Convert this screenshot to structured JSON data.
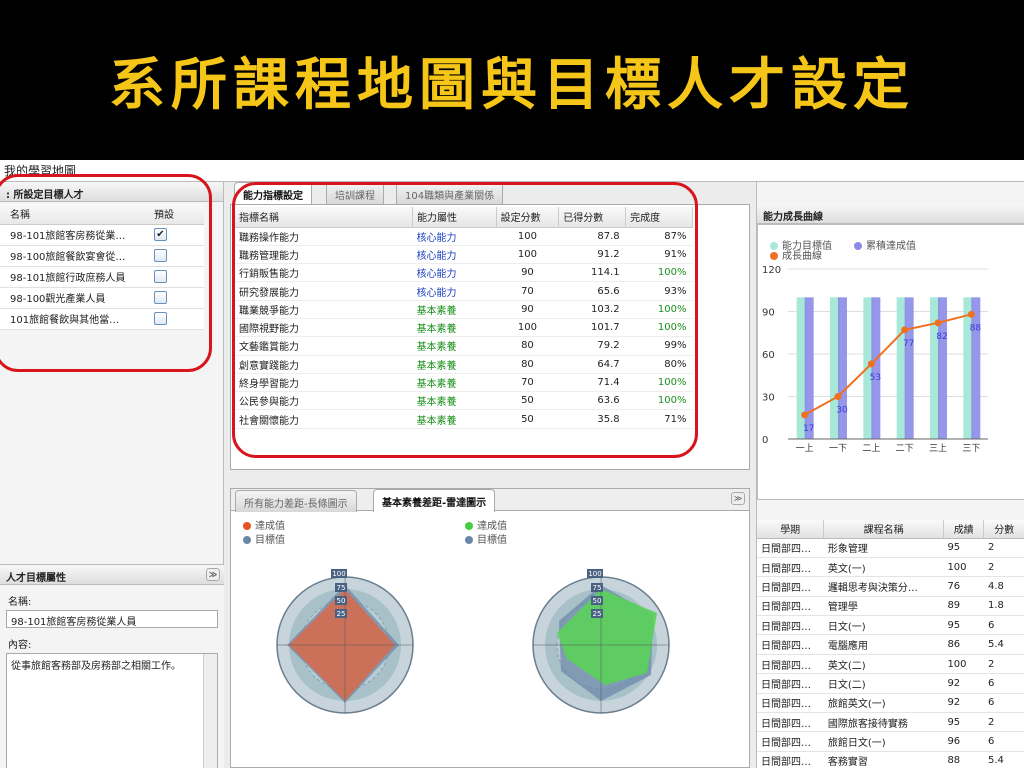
{
  "slide_title": "系所課程地圖與目標人才設定",
  "app": {
    "title": "我的學習地圖"
  },
  "target_section": {
    "title": ": 所設定目標人才",
    "headers": {
      "name": "名稱",
      "default": "預設"
    },
    "rows": [
      {
        "name": "98-101旅館客房務從業…",
        "checked": true
      },
      {
        "name": "98-100旅館餐飲宴會從…",
        "checked": false
      },
      {
        "name": "98-101旅館行政庶務人員",
        "checked": false
      },
      {
        "name": "98-100觀光產業人員",
        "checked": false
      },
      {
        "name": "101旅館餐飲與其他當…",
        "checked": false
      }
    ]
  },
  "attr_section": {
    "title": "人才目標屬性",
    "name_label": "名稱:",
    "name_value": "98-101旅館客房務從業人員",
    "content_label": "內容:",
    "content_value": "從事旅館客務部及房務部之相關工作。"
  },
  "center_tabs": [
    "能力指標設定",
    "培訓課程",
    "104職類與產業關係"
  ],
  "ability_table": {
    "headers": [
      "指標名稱",
      "能力屬性",
      "設定分數",
      "已得分數",
      "完成度"
    ],
    "rows": [
      {
        "name": "職務操作能力",
        "attr": "核心能力",
        "type": "core",
        "set": "100",
        "got": "87.8",
        "pct": "87%",
        "pct_green": false
      },
      {
        "name": "職務管理能力",
        "attr": "核心能力",
        "type": "core",
        "set": "100",
        "got": "91.2",
        "pct": "91%",
        "pct_green": false
      },
      {
        "name": "行銷販售能力",
        "attr": "核心能力",
        "type": "core",
        "set": "90",
        "got": "114.1",
        "pct": "100%",
        "pct_green": true
      },
      {
        "name": "研究發展能力",
        "attr": "核心能力",
        "type": "core",
        "set": "70",
        "got": "65.6",
        "pct": "93%",
        "pct_green": false
      },
      {
        "name": "職業競爭能力",
        "attr": "基本素養",
        "type": "basic",
        "set": "90",
        "got": "103.2",
        "pct": "100%",
        "pct_green": true
      },
      {
        "name": "國際視野能力",
        "attr": "基本素養",
        "type": "basic",
        "set": "100",
        "got": "101.7",
        "pct": "100%",
        "pct_green": true
      },
      {
        "name": "文藝鑑賞能力",
        "attr": "基本素養",
        "type": "basic",
        "set": "80",
        "got": "79.2",
        "pct": "99%",
        "pct_green": false
      },
      {
        "name": "創意實踐能力",
        "attr": "基本素養",
        "type": "basic",
        "set": "80",
        "got": "64.7",
        "pct": "80%",
        "pct_green": false
      },
      {
        "name": "終身學習能力",
        "attr": "基本素養",
        "type": "basic",
        "set": "70",
        "got": "71.4",
        "pct": "100%",
        "pct_green": true
      },
      {
        "name": "公民參與能力",
        "attr": "基本素養",
        "type": "basic",
        "set": "50",
        "got": "63.6",
        "pct": "100%",
        "pct_green": true
      },
      {
        "name": "社會關懷能力",
        "attr": "基本素養",
        "type": "basic",
        "set": "50",
        "got": "35.8",
        "pct": "71%",
        "pct_green": false
      }
    ]
  },
  "radar_tabs": [
    "所有能力差距-長條圖示",
    "基本素養差距-雷達圖示"
  ],
  "radar_legend": {
    "left": [
      {
        "label": "達成值",
        "color": "#e8502a"
      },
      {
        "label": "目標值",
        "color": "#6a86a8"
      }
    ],
    "right": [
      {
        "label": "達成值",
        "color": "#44cc44"
      },
      {
        "label": "目標值",
        "color": "#6a86a8"
      }
    ]
  },
  "radar_axis_labels": [
    "100",
    "75",
    "50",
    "25"
  ],
  "growth_chart": {
    "title": "能力成長曲線",
    "legend": [
      "能力目標值",
      "累積達成值",
      "成長曲線"
    ],
    "colors": {
      "target": "#a8e8d8",
      "achieved": "#8c8ce8",
      "line": "#f07020"
    }
  },
  "chart_data": {
    "type": "bar",
    "title": "能力成長曲線",
    "categories": [
      "一上",
      "一下",
      "二上",
      "二下",
      "三上",
      "三下"
    ],
    "series": [
      {
        "name": "能力目標值",
        "values": [
          100,
          100,
          100,
          100,
          100,
          100
        ]
      },
      {
        "name": "累積達成值",
        "values": [
          17,
          30,
          53,
          77,
          82,
          88
        ]
      },
      {
        "name": "成長曲線",
        "values": [
          17,
          30,
          53,
          77,
          82,
          88
        ]
      }
    ],
    "y_ticks": [
      "0",
      "30",
      "60",
      "90",
      "120"
    ],
    "ylim": [
      0,
      120
    ]
  },
  "course_table": {
    "headers": [
      "學期",
      "課程名稱",
      "成績",
      "分數"
    ],
    "rows": [
      [
        "日間部四…",
        "形象管理",
        "95",
        "2"
      ],
      [
        "日間部四…",
        "英文(一)",
        "100",
        "2"
      ],
      [
        "日間部四…",
        "邏輯思考與決策分…",
        "76",
        "4.8"
      ],
      [
        "日間部四…",
        "管理學",
        "89",
        "1.8"
      ],
      [
        "日間部四…",
        "日文(一)",
        "95",
        "6"
      ],
      [
        "日間部四…",
        "電腦應用",
        "86",
        "5.4"
      ],
      [
        "日間部四…",
        "英文(二)",
        "100",
        "2"
      ],
      [
        "日間部四…",
        "日文(二)",
        "92",
        "6"
      ],
      [
        "日間部四…",
        "旅館英文(一)",
        "92",
        "6"
      ],
      [
        "日間部四…",
        "國際旅客接待實務",
        "95",
        "2"
      ],
      [
        "日間部四…",
        "旅館日文(一)",
        "96",
        "6"
      ],
      [
        "日間部四…",
        "客務實習",
        "88",
        "5.4"
      ]
    ]
  }
}
